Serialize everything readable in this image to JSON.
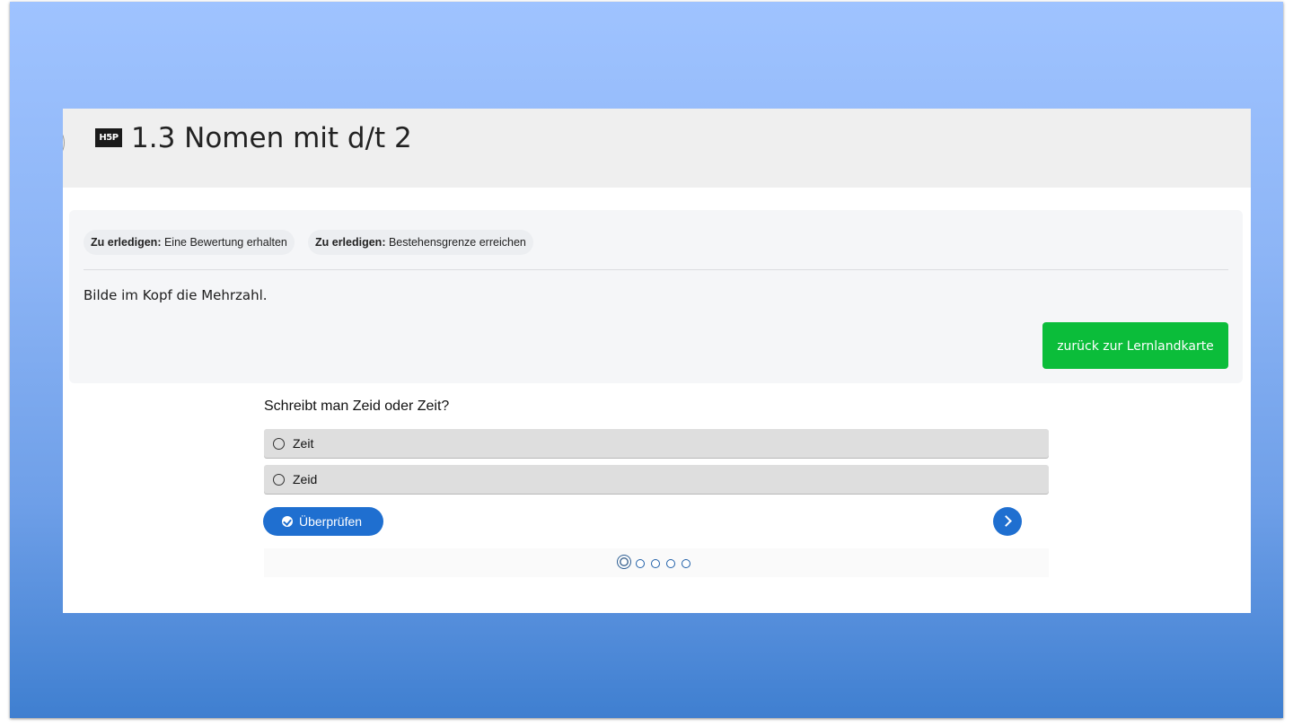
{
  "header": {
    "logo_text": "H5P",
    "title": "1.3 Nomen mit d/t 2"
  },
  "completion": {
    "badges": [
      {
        "prefix": "Zu erledigen:",
        "text": "Eine Bewertung erhalten"
      },
      {
        "prefix": "Zu erledigen:",
        "text": "Bestehensgrenze erreichen"
      }
    ]
  },
  "instruction": "Bilde im Kopf die Mehrzahl.",
  "back_button_label": "zurück zur Lernlandkarte",
  "quiz": {
    "question": "Schreibt man Zeid oder Zeit?",
    "options": [
      "Zeit",
      "Zeid"
    ],
    "check_label": "Überprüfen",
    "check_icon": "check-circle-icon",
    "next_icon": "chevron-right-icon",
    "progress": {
      "current": 1,
      "total": 5
    }
  },
  "colors": {
    "accent_blue": "#1f6fd0",
    "back_button_green": "#0bbd3a",
    "background_gradient_top": "#9fc3ff",
    "background_gradient_bottom": "#3f7fd0"
  }
}
